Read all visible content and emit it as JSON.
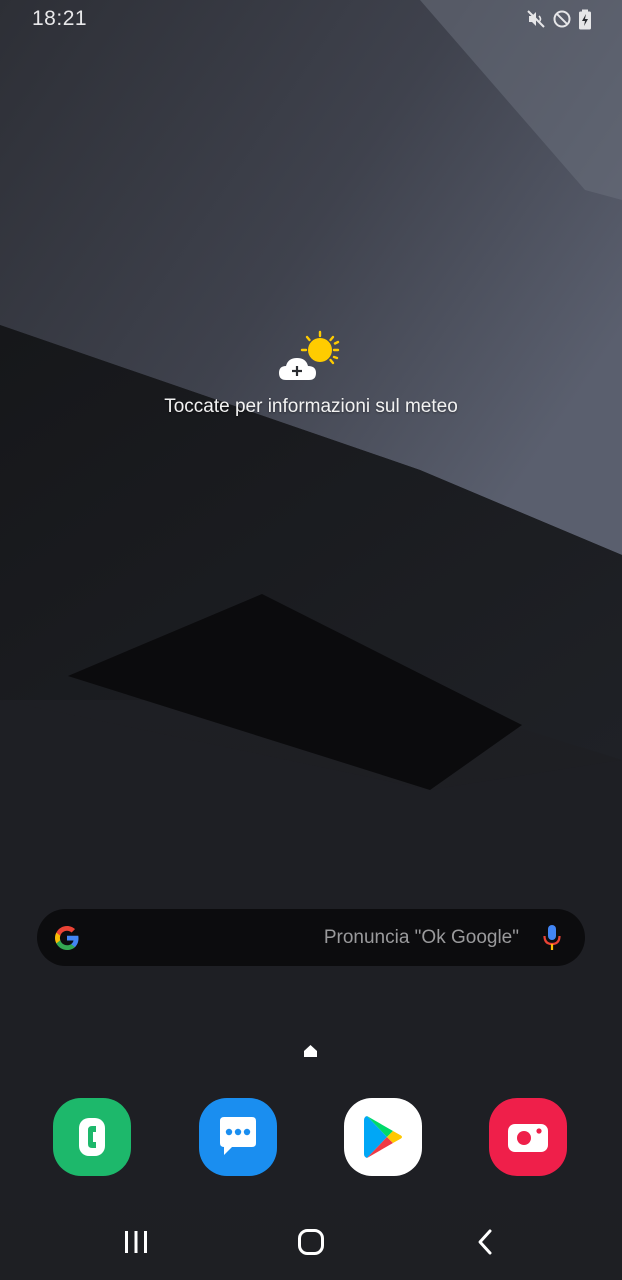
{
  "status_bar": {
    "time": "18:21",
    "icons": [
      "mute-icon",
      "do-not-disturb-icon",
      "battery-charging-icon"
    ]
  },
  "weather_widget": {
    "icon": "sun-cloud-add-icon",
    "prompt": "Toccate per informazioni sul meteo"
  },
  "search_widget": {
    "logo": "google-g-icon",
    "placeholder": "Pronuncia \"Ok Google\"",
    "mic": "microphone-icon"
  },
  "home_indicator": "home-page-indicator-icon",
  "dock": [
    {
      "icon": "phone-app-icon",
      "color": "#1db86b"
    },
    {
      "icon": "messages-app-icon",
      "color": "#1a8ef0"
    },
    {
      "icon": "play-store-app-icon",
      "color": "#ffffff"
    },
    {
      "icon": "camera-app-icon",
      "color": "#ef1f4a"
    }
  ],
  "nav_bar": [
    "recent-apps-icon",
    "home-button-icon",
    "back-icon"
  ],
  "colors": {
    "sun": "#ffcc00",
    "google_blue": "#4285f4",
    "google_red": "#ea4335",
    "google_yellow": "#fbbc05",
    "google_green": "#34a853"
  }
}
